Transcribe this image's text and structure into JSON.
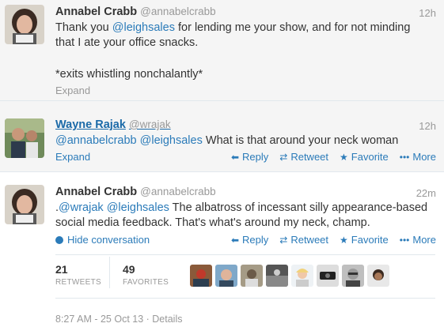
{
  "tweets": [
    {
      "name": "Annabel Crabb",
      "handle": "@annabelcrabb",
      "time": "12h",
      "line1_pre": "Thank you ",
      "line1_mention": "@leighsales",
      "line1_post": " for lending me your show, and for not minding",
      "line2": "that I ate your office snacks.",
      "line3": "*exits whistling nonchalantly*",
      "expand": "Expand"
    },
    {
      "name": "Wayne Rajak",
      "handle": "@wrajak",
      "time": "12h",
      "mention1": "@annabelcrabb",
      "mention2": "@leighsales",
      "text": " What is that around your neck woman",
      "expand": "Expand"
    },
    {
      "name": "Annabel Crabb",
      "handle": "@annabelcrabb",
      "time": "22m",
      "line1_pre": ".",
      "mention1": "@wrajak",
      "mention2": "@leighsales",
      "line1_post": " The albatross of incessant silly appearance-based",
      "line2": "social media feedback. That's what's around my neck, champ.",
      "hide_conversation": "Hide conversation"
    }
  ],
  "actions": {
    "reply": "Reply",
    "retweet": "Retweet",
    "favorite": "Favorite",
    "more": "More"
  },
  "stats": {
    "retweets_count": "21",
    "retweets_label": "RETWEETS",
    "favorites_count": "49",
    "favorites_label": "FAVORITES"
  },
  "footer": {
    "timestamp": "8:27 AM - 25 Oct 13",
    "separator": " · ",
    "details": "Details"
  },
  "colors": {
    "link": "#2b7bb9",
    "muted": "#999999",
    "divider": "#e1e8ed",
    "tweet_bg": "#f5f5f5"
  }
}
